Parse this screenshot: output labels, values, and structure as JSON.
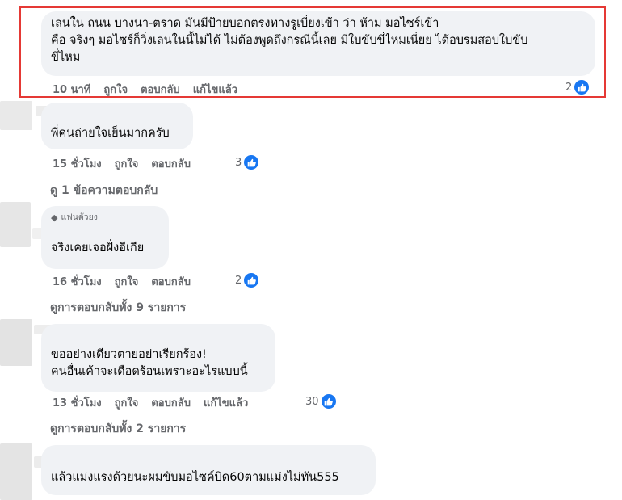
{
  "comments": [
    {
      "lines": [
        "เลนใน ถนน บางนา-ตราด มันมีป้ายบอกตรงทางรูเบี่ยงเข้า ว่า ห้าม มอไซร์เข้า",
        "คือ จริงๆ มอไซร์ก็วิ่งเลนในนี้ไม่ได้ ไม่ต้องพูดถึงกรณีนี้เลย มีใบขับขี่ไหมเนี่ยย ได้อบรมสอบใบขับ",
        "ขี่ไหม"
      ],
      "time": "10 นาที",
      "like": "ถูกใจ",
      "reply": "ตอบกลับ",
      "edited": "แก้ไขแล้ว",
      "reactions": "2"
    },
    {
      "lines": [
        "พี่คนถ่ายใจเย็นมากครับ"
      ],
      "time": "15 ชั่วโมง",
      "like": "ถูกใจ",
      "reply": "ตอบกลับ",
      "reactions": "3",
      "view_replies": "ดู 1 ข้อความตอบกลับ"
    },
    {
      "badge": "แฟนตัวยง",
      "lines": [
        "จริงเคยเจอฝั่งอีเกีย"
      ],
      "time": "16 ชั่วโมง",
      "like": "ถูกใจ",
      "reply": "ตอบกลับ",
      "reactions": "2",
      "view_replies": "ดูการตอบกลับทั้ง 9 รายการ"
    },
    {
      "lines": [
        "ขออย่างเดียวตายอย่าเรียกร้อง!",
        "คนอื่นเค้าจะเดือดร้อนเพราะอะไรแบบนี้"
      ],
      "time": "13 ชั่วโมง",
      "like": "ถูกใจ",
      "reply": "ตอบกลับ",
      "edited": "แก้ไขแล้ว",
      "reactions": "30",
      "view_replies": "ดูการตอบกลับทั้ง 2 รายการ"
    },
    {
      "lines": [
        "แล้วแม่งแรงด้วยนะผมขับมอไซค์บิด60ตามแม่งไม่ทัน555"
      ]
    }
  ],
  "icons": {
    "like": "thumbs-up-icon",
    "badge": "gem-icon"
  },
  "colors": {
    "like_blue": "#1877f2",
    "highlight_red": "#e53935",
    "bubble": "#f0f2f5"
  }
}
